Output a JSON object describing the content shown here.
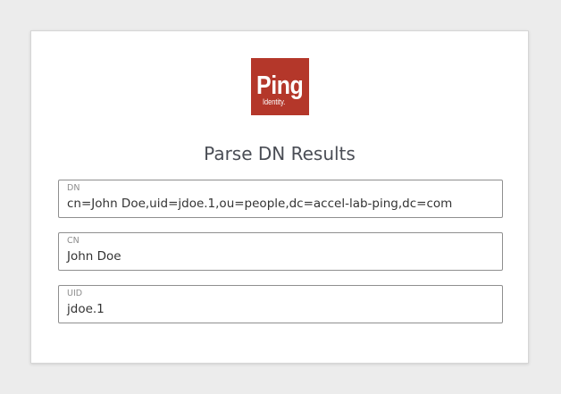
{
  "logo": {
    "wordmark": "Ping",
    "subtext": "Identity.",
    "background_color": "#b4372a"
  },
  "page": {
    "title": "Parse DN Results"
  },
  "fields": {
    "dn": {
      "label": "DN",
      "value": "cn=John Doe,uid=jdoe.1,ou=people,dc=accel-lab-ping,dc=com"
    },
    "cn": {
      "label": "CN",
      "value": "John Doe"
    },
    "uid": {
      "label": "UID",
      "value": "jdoe.1"
    }
  }
}
